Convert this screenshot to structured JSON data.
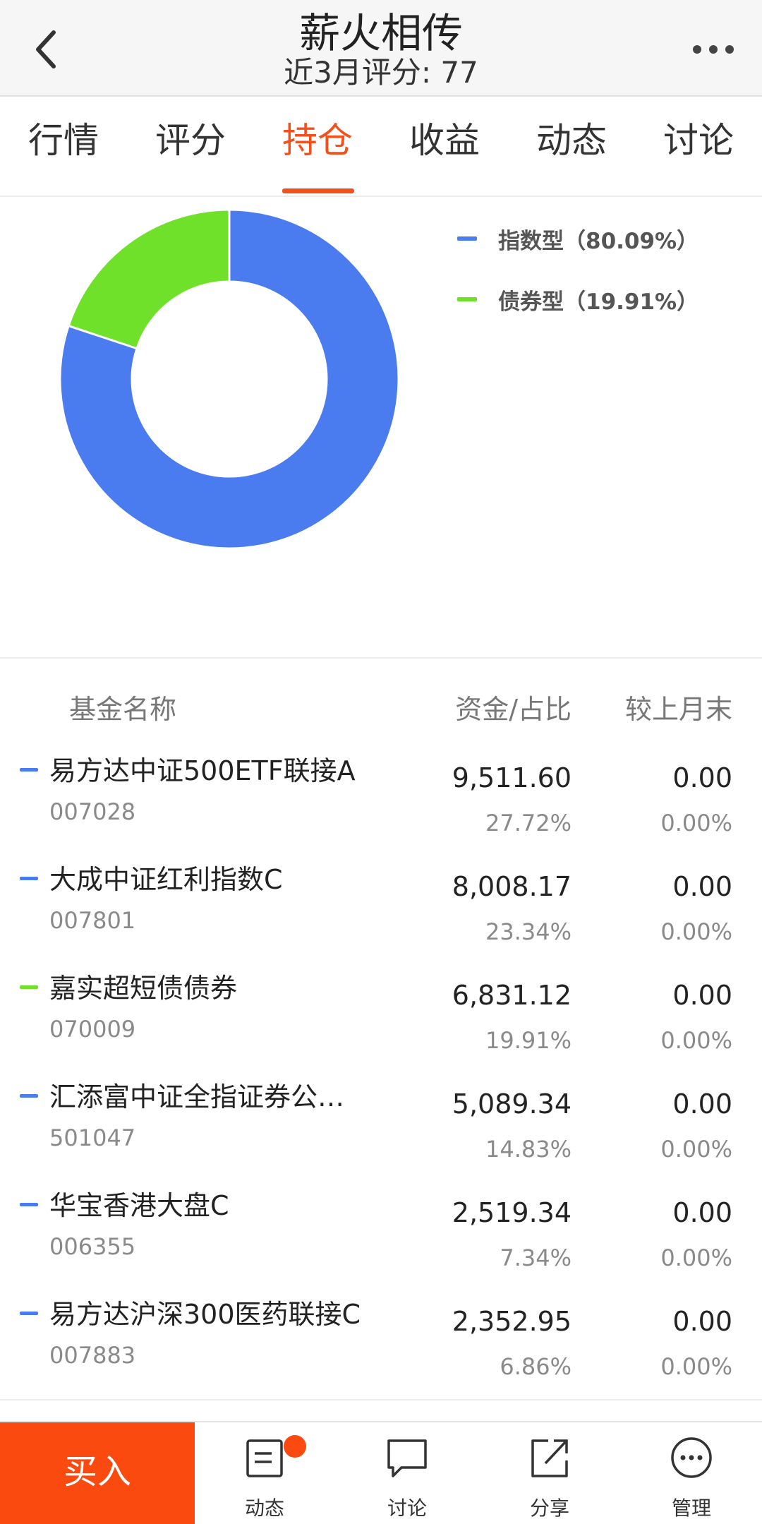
{
  "header": {
    "title": "薪火相传",
    "subtitle": "近3月评分: 77"
  },
  "tabs": [
    {
      "label": "行情"
    },
    {
      "label": "评分"
    },
    {
      "label": "持仓",
      "active": true
    },
    {
      "label": "收益"
    },
    {
      "label": "动态"
    },
    {
      "label": "讨论"
    }
  ],
  "colors": {
    "accent": "#f2511b",
    "buy": "#fa4a0f",
    "index_series": "#4a7bef",
    "bond_series": "#6fe12a"
  },
  "chart_data": {
    "type": "pie",
    "style": "donut",
    "legend_position": "top-right",
    "slices": [
      {
        "name": "指数型",
        "value": 80.09,
        "label": "指数型（80.09%）",
        "color": "#4a7bef"
      },
      {
        "name": "债券型",
        "value": 19.91,
        "label": "债券型（19.91%）",
        "color": "#6fe12a"
      }
    ]
  },
  "table": {
    "headers": {
      "name": "基金名称",
      "amount": "资金/占比",
      "change": "较上月末"
    },
    "rows": [
      {
        "name": "易方达中证500ETF联接A",
        "code": "007028",
        "amount": "9,511.60",
        "ratio": "27.72%",
        "change": "0.00",
        "change_pct": "0.00%",
        "type": "index"
      },
      {
        "name": "大成中证红利指数C",
        "code": "007801",
        "amount": "8,008.17",
        "ratio": "23.34%",
        "change": "0.00",
        "change_pct": "0.00%",
        "type": "index"
      },
      {
        "name": "嘉实超短债债券",
        "code": "070009",
        "amount": "6,831.12",
        "ratio": "19.91%",
        "change": "0.00",
        "change_pct": "0.00%",
        "type": "bond"
      },
      {
        "name": "汇添富中证全指证券公…",
        "code": "501047",
        "amount": "5,089.34",
        "ratio": "14.83%",
        "change": "0.00",
        "change_pct": "0.00%",
        "type": "index"
      },
      {
        "name": "华宝香港大盘C",
        "code": "006355",
        "amount": "2,519.34",
        "ratio": "7.34%",
        "change": "0.00",
        "change_pct": "0.00%",
        "type": "index"
      },
      {
        "name": "易方达沪深300医药联接C",
        "code": "007883",
        "amount": "2,352.95",
        "ratio": "6.86%",
        "change": "0.00",
        "change_pct": "0.00%",
        "type": "index"
      }
    ]
  },
  "bottom_bar": {
    "buy_label": "买入",
    "items": [
      {
        "label": "动态",
        "icon": "news-icon",
        "badge": true
      },
      {
        "label": "讨论",
        "icon": "chat-bubble-icon"
      },
      {
        "label": "分享",
        "icon": "share-icon"
      },
      {
        "label": "管理",
        "icon": "more-circle-icon"
      }
    ]
  }
}
